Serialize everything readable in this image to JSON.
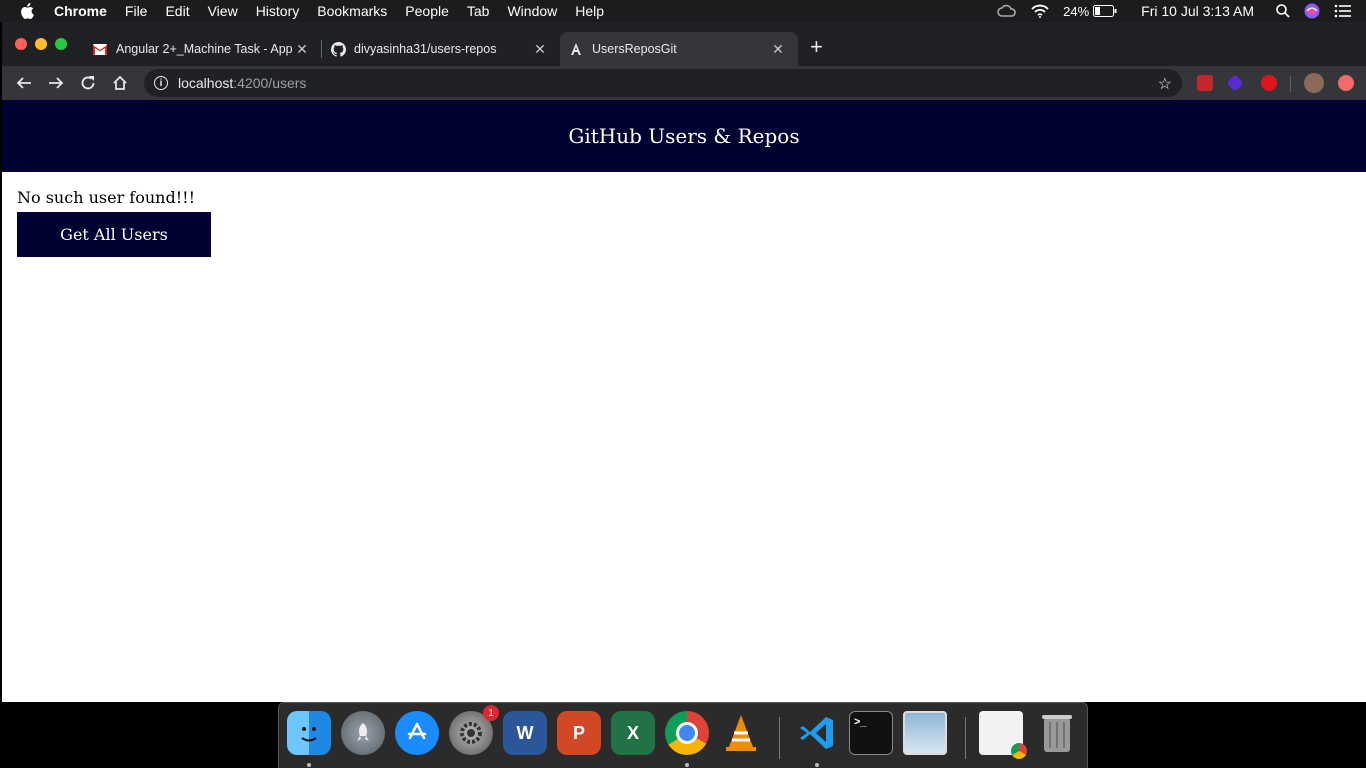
{
  "menubar": {
    "app_name": "Chrome",
    "items": [
      "File",
      "Edit",
      "View",
      "History",
      "Bookmarks",
      "People",
      "Tab",
      "Window",
      "Help"
    ],
    "battery": "24%",
    "datetime": "Fri 10 Jul  3:13 AM"
  },
  "browser": {
    "tabs": [
      {
        "title": "Angular 2+_Machine Task - App",
        "icon": "gmail-icon"
      },
      {
        "title": "divyasinha31/users-repos",
        "icon": "github-icon"
      },
      {
        "title": "UsersReposGit",
        "icon": "angular-icon"
      }
    ],
    "url_host": "localhost",
    "url_path": ":4200/users"
  },
  "page": {
    "header_title": "GitHub Users & Repos",
    "message": "No such user found!!!",
    "button_label": "Get All Users"
  },
  "dock": {
    "apps": [
      "Finder",
      "Launchpad",
      "App Store",
      "System Preferences",
      "Word",
      "PowerPoint",
      "Excel",
      "Chrome",
      "VLC",
      "VS Code",
      "Terminal",
      "Preview",
      "Chrome Window",
      "Trash"
    ],
    "system_preferences_badge": "1"
  },
  "colors": {
    "header_bg": "#010132",
    "button_bg": "#010132",
    "tabstrip_bg": "#202124",
    "toolbar_bg": "#35363a"
  }
}
